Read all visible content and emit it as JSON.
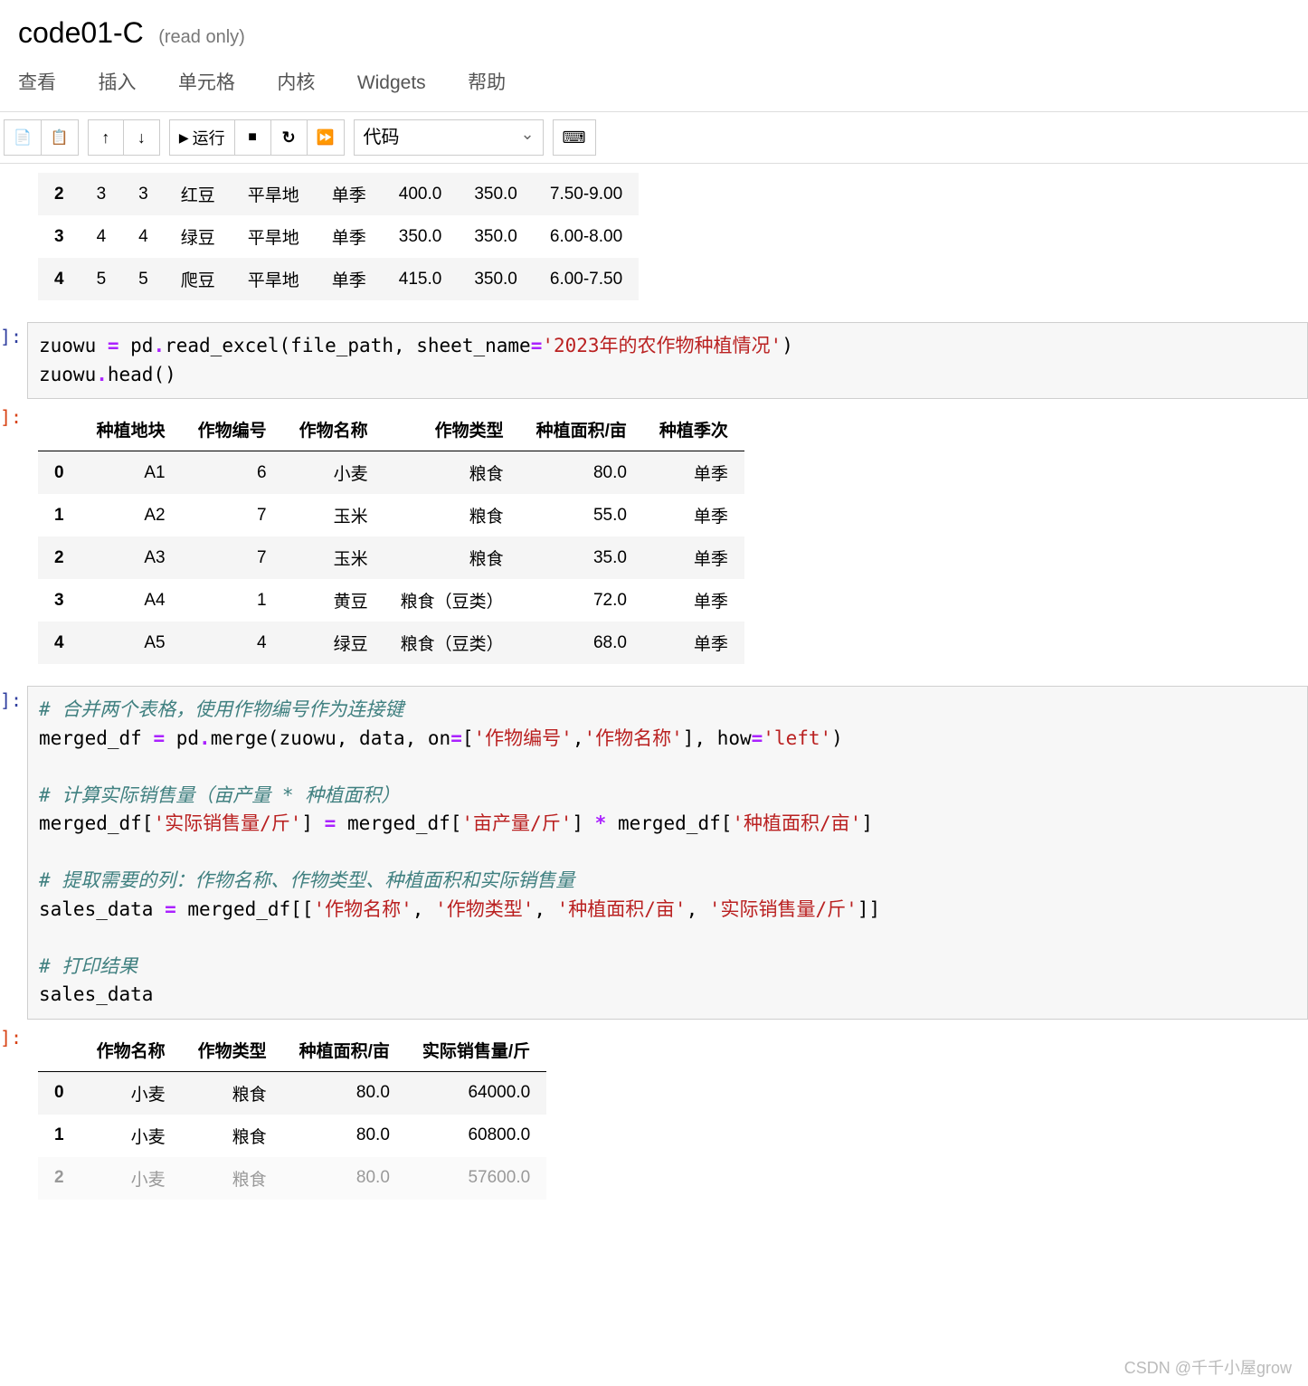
{
  "header": {
    "title": "code01-C",
    "readonly": "(read only)"
  },
  "menu": {
    "items": [
      "查看",
      "插入",
      "单元格",
      "内核",
      "Widgets",
      "帮助"
    ]
  },
  "toolbar": {
    "run": "运行",
    "celltype": "代码"
  },
  "table1": {
    "rows": [
      {
        "idx": "2",
        "c0": "3",
        "c1": "3",
        "c2": "红豆",
        "c3": "平旱地",
        "c4": "单季",
        "c5": "400.0",
        "c6": "350.0",
        "c7": "7.50-9.00"
      },
      {
        "idx": "3",
        "c0": "4",
        "c1": "4",
        "c2": "绿豆",
        "c3": "平旱地",
        "c4": "单季",
        "c5": "350.0",
        "c6": "350.0",
        "c7": "6.00-8.00"
      },
      {
        "idx": "4",
        "c0": "5",
        "c1": "5",
        "c2": "爬豆",
        "c3": "平旱地",
        "c4": "单季",
        "c5": "415.0",
        "c6": "350.0",
        "c7": "6.00-7.50"
      }
    ]
  },
  "code1": {
    "line1a": "zuowu ",
    "line1b": "=",
    "line1c": " pd",
    "line1d": ".",
    "line1e": "read_excel(file_path, sheet_name",
    "line1f": "=",
    "line1g": "'2023年的农作物种植情况'",
    "line1h": ")",
    "line2a": "zuowu",
    "line2b": ".",
    "line2c": "head()"
  },
  "table2": {
    "headers": [
      "",
      "种植地块",
      "作物编号",
      "作物名称",
      "作物类型",
      "种植面积/亩",
      "种植季次"
    ],
    "rows": [
      {
        "idx": "0",
        "c0": "A1",
        "c1": "6",
        "c2": "小麦",
        "c3": "粮食",
        "c4": "80.0",
        "c5": "单季"
      },
      {
        "idx": "1",
        "c0": "A2",
        "c1": "7",
        "c2": "玉米",
        "c3": "粮食",
        "c4": "55.0",
        "c5": "单季"
      },
      {
        "idx": "2",
        "c0": "A3",
        "c1": "7",
        "c2": "玉米",
        "c3": "粮食",
        "c4": "35.0",
        "c5": "单季"
      },
      {
        "idx": "3",
        "c0": "A4",
        "c1": "1",
        "c2": "黄豆",
        "c3": "粮食（豆类）",
        "c4": "72.0",
        "c5": "单季"
      },
      {
        "idx": "4",
        "c0": "A5",
        "c1": "4",
        "c2": "绿豆",
        "c3": "粮食（豆类）",
        "c4": "68.0",
        "c5": "单季"
      }
    ]
  },
  "code2": {
    "c1": "# 合并两个表格，使用作物编号作为连接键",
    "l2a": "merged_df ",
    "l2b": "=",
    "l2c": " pd",
    "l2d": ".",
    "l2e": "merge(zuowu, data, on",
    "l2f": "=",
    "l2g": "[",
    "l2h": "'作物编号'",
    "l2i": ",",
    "l2j": "'作物名称'",
    "l2k": "], how",
    "l2l": "=",
    "l2m": "'left'",
    "l2n": ")",
    "c2": "# 计算实际销售量（亩产量 * 种植面积）",
    "l4a": "merged_df[",
    "l4b": "'实际销售量/斤'",
    "l4c": "] ",
    "l4d": "=",
    "l4e": " merged_df[",
    "l4f": "'亩产量/斤'",
    "l4g": "] ",
    "l4h": "*",
    "l4i": " merged_df[",
    "l4j": "'种植面积/亩'",
    "l4k": "]",
    "c3": "# 提取需要的列：作物名称、作物类型、种植面积和实际销售量",
    "l6a": "sales_data ",
    "l6b": "=",
    "l6c": " merged_df[[",
    "l6d": "'作物名称'",
    "l6e": ", ",
    "l6f": "'作物类型'",
    "l6g": ", ",
    "l6h": "'种植面积/亩'",
    "l6i": ", ",
    "l6j": "'实际销售量/斤'",
    "l6k": "]]",
    "c4": "# 打印结果",
    "l8": "sales_data"
  },
  "table3": {
    "headers": [
      "",
      "作物名称",
      "作物类型",
      "种植面积/亩",
      "实际销售量/斤"
    ],
    "rows": [
      {
        "idx": "0",
        "c0": "小麦",
        "c1": "粮食",
        "c2": "80.0",
        "c3": "64000.0"
      },
      {
        "idx": "1",
        "c0": "小麦",
        "c1": "粮食",
        "c2": "80.0",
        "c3": "60800.0"
      },
      {
        "idx": "2",
        "c0": "小麦",
        "c1": "粮食",
        "c2": "80.0",
        "c3": "57600.0"
      }
    ]
  },
  "footer": "CSDN @千千小屋grow",
  "bracket": "]:"
}
